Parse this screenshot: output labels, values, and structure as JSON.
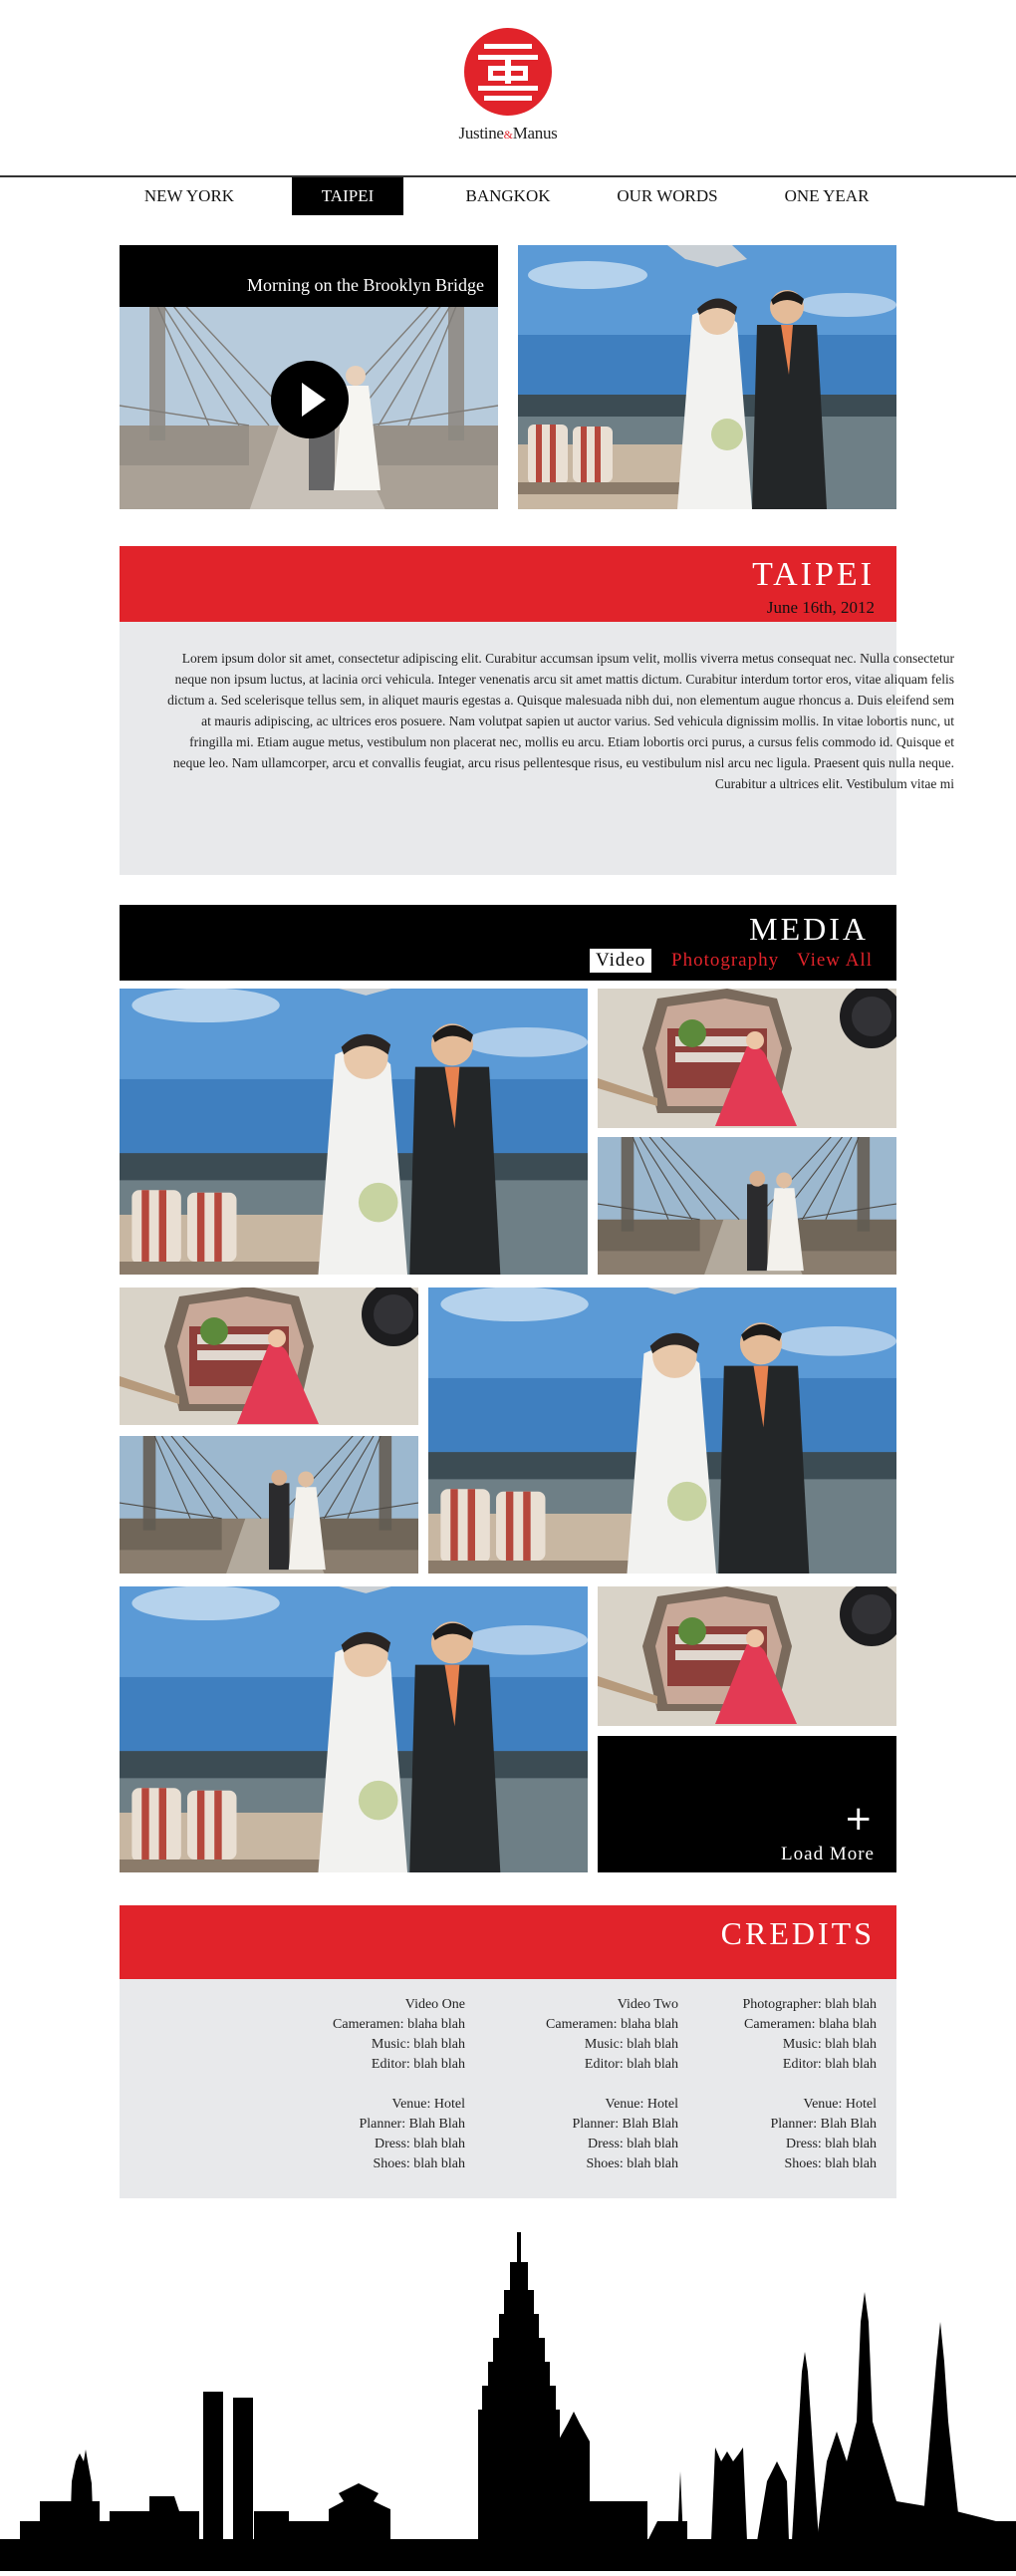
{
  "brand": {
    "left": "Justine",
    "amp": "&",
    "right": "Manus",
    "accent": "#e1232a"
  },
  "nav": [
    {
      "label": "NEW YORK"
    },
    {
      "label": "TAIPEI"
    },
    {
      "label": "BANGKOK"
    },
    {
      "label": "OUR WORDS"
    },
    {
      "label": "ONE YEAR"
    }
  ],
  "feature": {
    "video_title": "Morning on the Brooklyn Bridge"
  },
  "location": {
    "title": "TAIPEI",
    "date": "June 16th, 2012",
    "body": "Lorem ipsum dolor sit amet, consectetur adipiscing elit. Curabitur accumsan ipsum velit, mollis viverra metus consequat nec. Nulla consectetur neque non ipsum luctus, at lacinia orci vehicula. Integer venenatis arcu sit amet mattis dictum. Curabitur interdum tortor eros, vitae aliquam felis dictum a. Sed scelerisque tellus sem, in aliquet mauris egestas a. Quisque malesuada nibh dui, non elementum augue rhoncus a. Duis eleifend sem at mauris adipiscing, ac ultrices eros posuere. Nam volutpat sapien ut auctor varius. Sed vehicula dignissim mollis. In vitae lobortis nunc, ut fringilla mi. Etiam augue metus, vestibulum non placerat nec, mollis eu arcu. Etiam lobortis orci purus, a cursus felis commodo id. Quisque et neque leo. Nam ullamcorper, arcu et convallis feugiat, arcu risus pellentesque risus, eu vestibulum nisl arcu nec ligula. Praesent quis nulla neque. Curabitur a ultrices elit. Vestibulum vitae mi"
  },
  "media": {
    "title": "MEDIA",
    "tabs": [
      {
        "label": "Video"
      },
      {
        "label": "Photography"
      },
      {
        "label": "View All"
      }
    ],
    "load_more": {
      "label": "Load More",
      "icon": "plus-icon"
    }
  },
  "credits": {
    "title": "CREDITS",
    "columns": [
      {
        "top": [
          "Video One",
          "Cameramen: blaha blah",
          "Music: blah blah",
          "Editor: blah blah"
        ],
        "bottom": [
          "Venue: Hotel",
          "Planner: Blah Blah",
          "Dress: blah blah",
          "Shoes: blah blah"
        ]
      },
      {
        "top": [
          "Video Two",
          "Cameramen: blaha blah",
          "Music: blah blah",
          "Editor: blah blah"
        ],
        "bottom": [
          "Venue: Hotel",
          "Planner: Blah Blah",
          "Dress: blah blah",
          "Shoes: blah blah"
        ]
      },
      {
        "top": [
          "Photographer: blah blah",
          "Cameramen: blaha blah",
          "Music: blah blah",
          "Editor: blah blah"
        ],
        "bottom": [
          "Venue: Hotel",
          "Planner: Blah Blah",
          "Dress: blah blah",
          "Shoes: blah blah"
        ]
      }
    ]
  },
  "colors": {
    "accent_red": "#e1232a",
    "panel_grey": "#e8e9eb",
    "black": "#000000"
  }
}
